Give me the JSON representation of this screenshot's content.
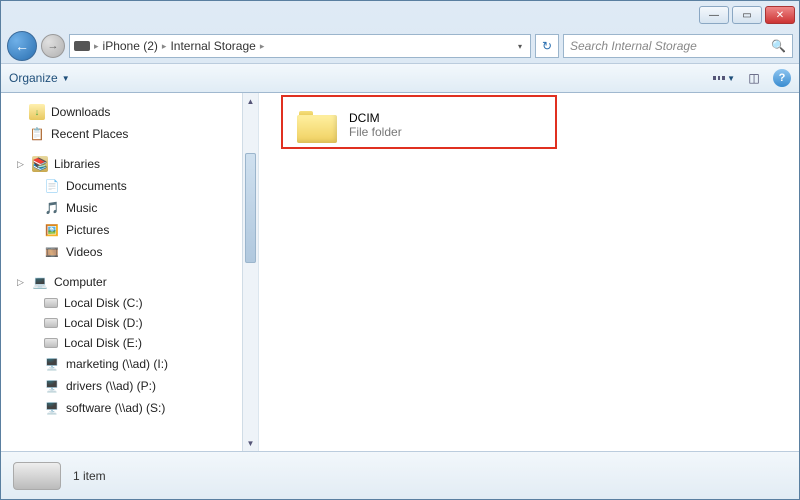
{
  "breadcrumb": {
    "segments": [
      "iPhone (2)",
      "Internal Storage"
    ]
  },
  "search": {
    "placeholder": "Search Internal Storage"
  },
  "toolbar": {
    "organize": "Organize"
  },
  "nav": {
    "downloads": "Downloads",
    "recent": "Recent Places",
    "libraries": "Libraries",
    "documents": "Documents",
    "music": "Music",
    "pictures": "Pictures",
    "videos": "Videos",
    "computer": "Computer",
    "disks": [
      "Local Disk (C:)",
      "Local Disk (D:)",
      "Local Disk (E:)"
    ],
    "network": [
      "marketing (\\\\ad) (I:)",
      "drivers (\\\\ad) (P:)",
      "software (\\\\ad) (S:)"
    ]
  },
  "content": {
    "folder": {
      "name": "DCIM",
      "type": "File folder"
    }
  },
  "status": {
    "count": "1 item"
  }
}
